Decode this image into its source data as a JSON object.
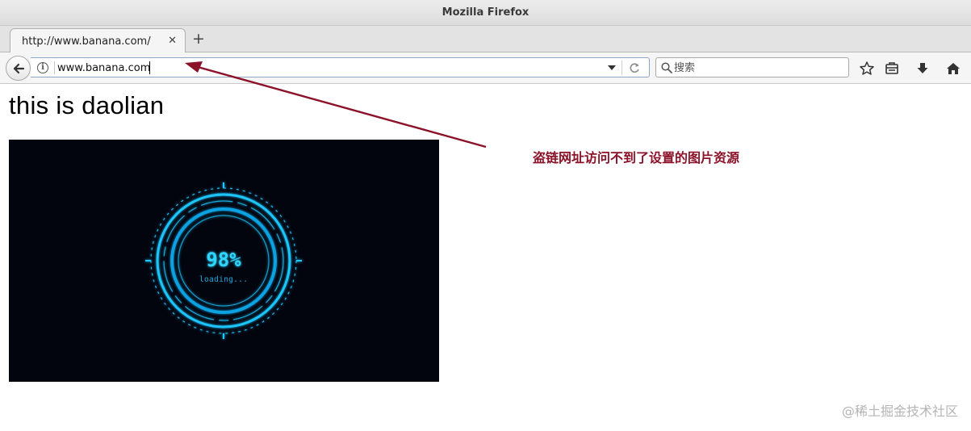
{
  "window": {
    "title": "Mozilla Firefox"
  },
  "tabs": [
    {
      "label": "http://www.banana.com/"
    }
  ],
  "navbar": {
    "url_value": "www.banana.com",
    "search_placeholder": "搜索"
  },
  "page": {
    "heading": "this is daolian",
    "image": {
      "progress_text": "98%",
      "status_text": "loading...",
      "progress_percent": 98
    }
  },
  "annotation": {
    "text": "盗链网址访问不到了设置的图片资源",
    "color": "#8b1228"
  },
  "watermark": "@稀土掘金技术社区",
  "colors": {
    "accent": "#8b1228",
    "hud_cyan": "#1cc8ff"
  },
  "icons": [
    "back-arrow-icon",
    "info-icon",
    "dropdown-icon",
    "reload-icon",
    "search-icon",
    "bookmark-star-icon",
    "reading-list-icon",
    "download-icon",
    "home-icon",
    "close-icon",
    "plus-icon"
  ]
}
